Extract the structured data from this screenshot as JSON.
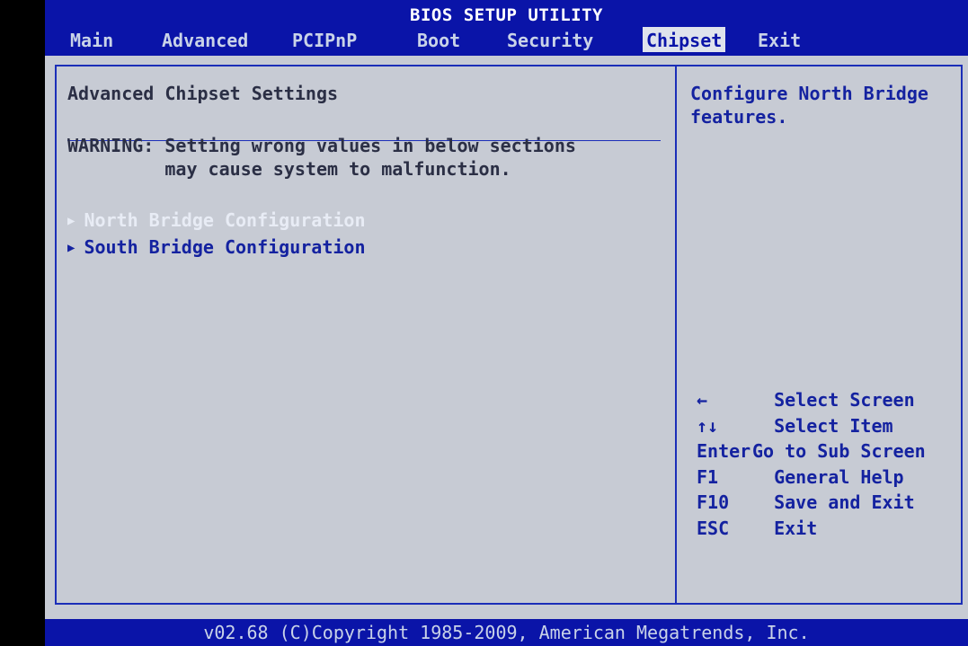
{
  "title": "BIOS SETUP UTILITY",
  "menu": [
    {
      "label": "Main",
      "active": false
    },
    {
      "label": "Advanced",
      "active": false
    },
    {
      "label": "PCIPnP",
      "active": false
    },
    {
      "label": "Boot",
      "active": false
    },
    {
      "label": "Security",
      "active": false
    },
    {
      "label": "Chipset",
      "active": true
    },
    {
      "label": "Exit",
      "active": false
    }
  ],
  "main": {
    "heading": "Advanced Chipset Settings",
    "warning": "WARNING: Setting wrong values in below sections\n         may cause system to malfunction.",
    "items": [
      {
        "label": "North Bridge Configuration",
        "selected": true
      },
      {
        "label": "South Bridge Configuration",
        "selected": false
      }
    ]
  },
  "help": {
    "text": "Configure North Bridge features.",
    "keys": [
      {
        "key": "←",
        "desc": "  Select Screen"
      },
      {
        "key": "↑↓",
        "desc": "  Select Item"
      },
      {
        "key": "Enter",
        "desc": "Go to Sub Screen"
      },
      {
        "key": "F1",
        "desc": "  General Help"
      },
      {
        "key": "F10",
        "desc": "  Save and Exit"
      },
      {
        "key": "ESC",
        "desc": "  Exit"
      }
    ]
  },
  "footer": "v02.68 (C)Copyright 1985-2009, American Megatrends, Inc.",
  "colors": {
    "bar": "#0a14a8",
    "body": "#c7cbd4",
    "accent": "#1422a0",
    "highlight": "#e8ecf5"
  }
}
